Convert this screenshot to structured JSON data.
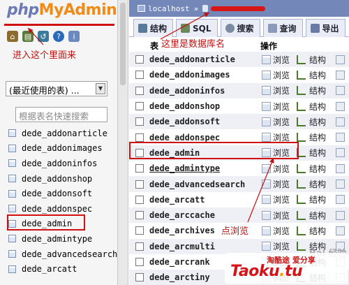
{
  "left": {
    "logo": {
      "php": "php",
      "my": "My",
      "admin": "Admin"
    },
    "annotation_enter": "进入这个里面来",
    "recent_select_value": "(最近使用的表) ...",
    "filter_placeholder": "根据表名快速搜索",
    "tables": [
      "dede_addonarticle",
      "dede_addonimages",
      "dede_addoninfos",
      "dede_addonshop",
      "dede_addonsoft",
      "dede_addonspec",
      "dede_admin",
      "dede_admintype",
      "dede_advancedsearch",
      "dede_arcatt"
    ]
  },
  "right": {
    "breadcrumb": {
      "server": "localhost",
      "separator": "»"
    },
    "tabs": [
      {
        "label": "结构"
      },
      {
        "label": "SQL"
      },
      {
        "label": "搜索"
      },
      {
        "label": "查询"
      },
      {
        "label": "导出"
      }
    ],
    "annotation_db": "这里是数据库名",
    "header": {
      "table": "表",
      "actions": "操作"
    },
    "rows": [
      {
        "name": "dede_addonarticle",
        "browse": "浏览",
        "structure": "结构"
      },
      {
        "name": "dede_addonimages",
        "browse": "浏览",
        "structure": "结构"
      },
      {
        "name": "dede_addoninfos",
        "browse": "浏览",
        "structure": "结构"
      },
      {
        "name": "dede_addonshop",
        "browse": "浏览",
        "structure": "结构"
      },
      {
        "name": "dede_addonsoft",
        "browse": "浏览",
        "structure": "结构"
      },
      {
        "name": "dede_addonspec",
        "browse": "浏览",
        "structure": "结构"
      },
      {
        "name": "dede_admin",
        "browse": "浏览",
        "structure": "结构"
      },
      {
        "name": "dede_admintype",
        "browse": "浏览",
        "structure": "结构"
      },
      {
        "name": "dede_advancedsearch",
        "browse": "浏览",
        "structure": "结构"
      },
      {
        "name": "dede_arcatt",
        "browse": "浏览",
        "structure": "结构"
      },
      {
        "name": "dede_arccache",
        "browse": "浏览",
        "structure": "结构"
      },
      {
        "name": "dede_archives",
        "browse": "浏览",
        "structure": "结构"
      },
      {
        "name": "dede_arcmulti",
        "browse": "浏览",
        "structure": "结构"
      },
      {
        "name": "dede_arcrank",
        "browse": "浏览",
        "structure": "结构"
      },
      {
        "name": "dede_arctiny",
        "browse": "浏览",
        "structure": "结构"
      }
    ],
    "annotation_browse": "点浏览",
    "watermark": "Bai 经验"
  },
  "brand": {
    "tagline": "淘酷途 爱分享",
    "name_a": "Taoku",
    "dot": ".",
    "name_b": "tu"
  },
  "colors": {
    "annotation": "#c01010",
    "highlight_box": "#d01010",
    "breadcrumb_bg": "#7388b8",
    "logo_orange": "#f08b17",
    "logo_blue": "#6c79b5"
  }
}
